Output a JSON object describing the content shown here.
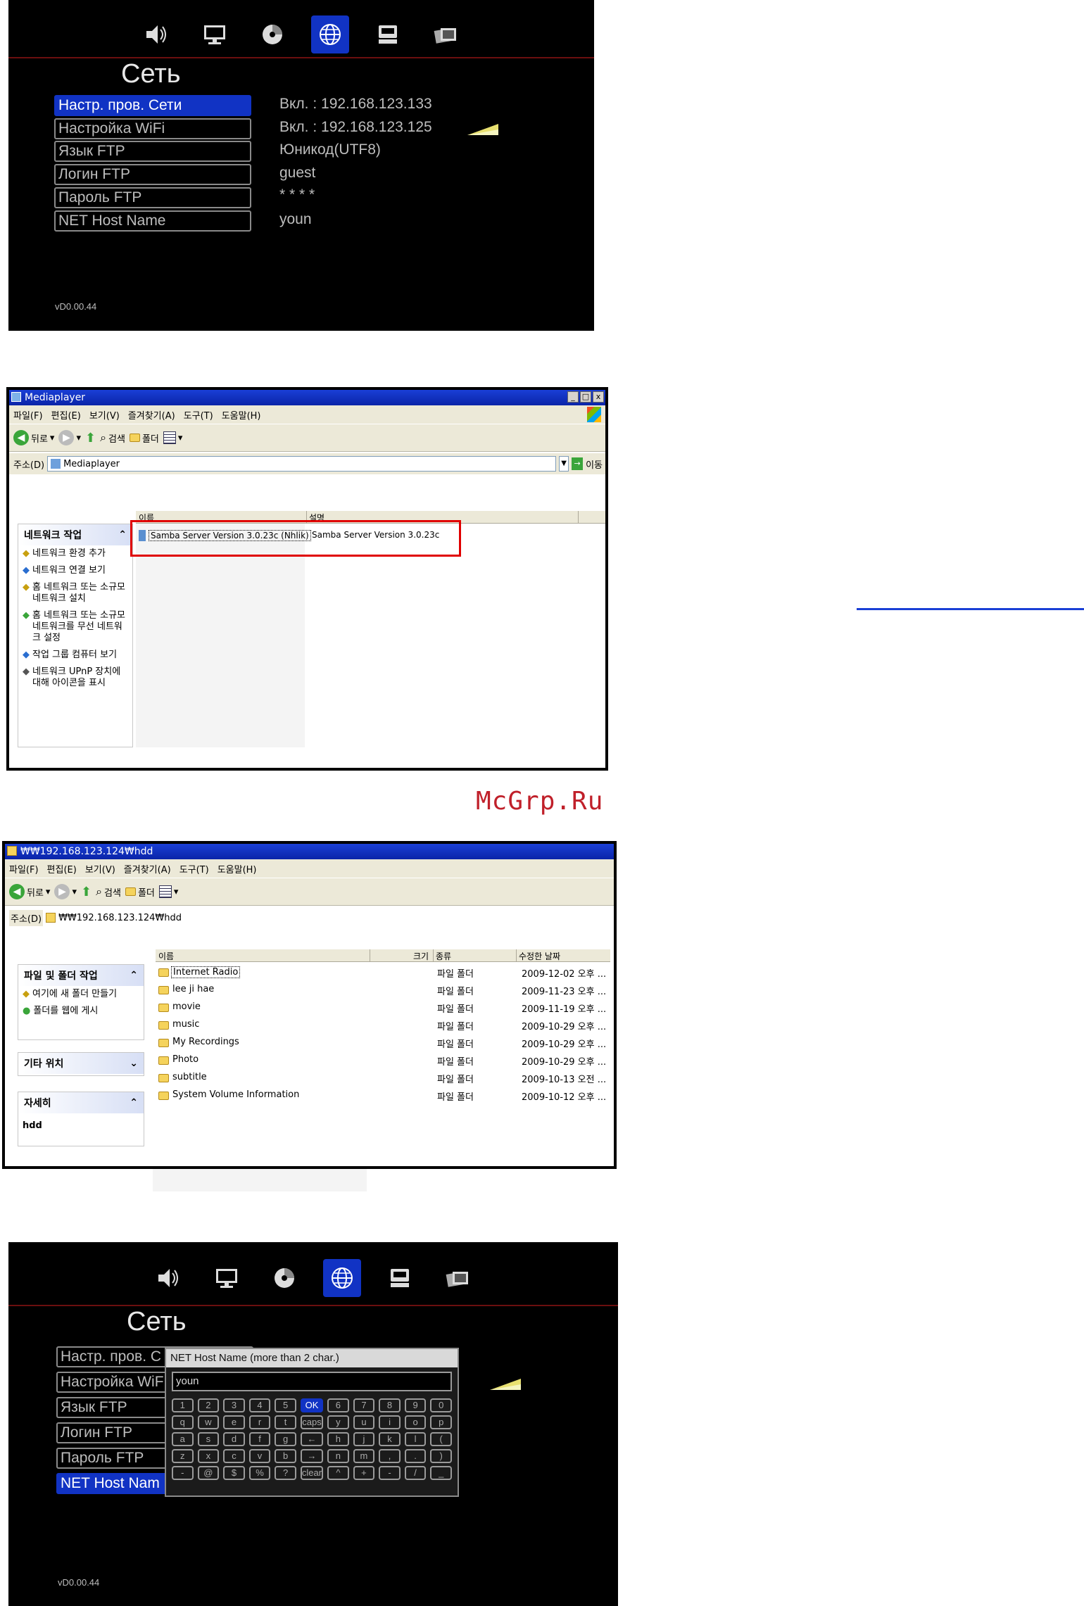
{
  "osd1": {
    "title": "Сеть",
    "menu": [
      {
        "label": "Настр. пров. Сети",
        "value": "Вкл. : 192.168.123.133"
      },
      {
        "label": "Настройка WiFi",
        "value": "Вкл. : 192.168.123.125"
      },
      {
        "label": "Язык FTP",
        "value": "Юникод(UTF8)"
      },
      {
        "label": "Логин FTP",
        "value": "guest"
      },
      {
        "label": "Пароль FTP",
        "value": "* * * *"
      },
      {
        "label": "NET Host Name",
        "value": "youn"
      }
    ],
    "selected_index": 0,
    "version": "vD0.00.44",
    "icons": [
      "speaker-icon",
      "monitor-icon",
      "disc-icon",
      "globe-icon",
      "network-drive-icon",
      "photo-icon"
    ],
    "active_icon": "globe-icon"
  },
  "win1": {
    "title": "Mediaplayer",
    "menu": [
      "파일(F)",
      "편집(E)",
      "보기(V)",
      "즐겨찾기(A)",
      "도구(T)",
      "도움말(H)"
    ],
    "toolbar": {
      "back": "뒤로",
      "search": "검색",
      "folders": "폴더"
    },
    "address_label": "주소(D)",
    "address_value": "Mediaplayer",
    "go_label": "이동",
    "side_title": "네트워크 작업",
    "side_items": [
      "네트워크 환경 추가",
      "네트워크 연결 보기",
      "홈 네트워크 또는 소규모 네트워크 설치",
      "홈 네트워크 또는 소규모 네트워크를 무선 네트워크 설정",
      "작업 그룹 컴퓨터 보기",
      "네트워크 UPnP 장치에 대해 아이콘을 표시"
    ],
    "columns": [
      "이름",
      "설명"
    ],
    "rows": [
      {
        "name": "Samba Server Version 3.0.23c (Nhlik)",
        "desc": "Samba Server Version 3.0.23c"
      }
    ]
  },
  "watermark": "McGrp.Ru",
  "win2": {
    "title": "₩₩192.168.123.124₩hdd",
    "menu": [
      "파일(F)",
      "편집(E)",
      "보기(V)",
      "즐겨찾기(A)",
      "도구(T)",
      "도움말(H)"
    ],
    "toolbar": {
      "back": "뒤로",
      "search": "검색",
      "folders": "폴더"
    },
    "address_label": "주소(D)",
    "address_value": "₩₩192.168.123.124₩hdd",
    "panels": [
      {
        "title": "파일 및 폴더 작업",
        "items": [
          "여기에 새 폴더 만들기",
          "폴더를 웹에 게시"
        ]
      },
      {
        "title": "기타 위치",
        "items": []
      },
      {
        "title": "자세히",
        "items": [
          "hdd"
        ]
      }
    ],
    "columns": [
      "이름",
      "크기",
      "종류",
      "수정한 날짜"
    ],
    "rows": [
      {
        "name": "Internet Radio",
        "type": "파일 폴더",
        "date": "2009-12-02 오후 ..."
      },
      {
        "name": "lee ji hae",
        "type": "파일 폴더",
        "date": "2009-11-23 오후 ..."
      },
      {
        "name": "movie",
        "type": "파일 폴더",
        "date": "2009-11-19 오후 ..."
      },
      {
        "name": "music",
        "type": "파일 폴더",
        "date": "2009-10-29 오후 ..."
      },
      {
        "name": "My Recordings",
        "type": "파일 폴더",
        "date": "2009-10-29 오후 ..."
      },
      {
        "name": "Photo",
        "type": "파일 폴더",
        "date": "2009-10-29 오후 ..."
      },
      {
        "name": "subtitle",
        "type": "파일 폴더",
        "date": "2009-10-13 오전 ..."
      },
      {
        "name": "System Volume Information",
        "type": "파일 폴더",
        "date": "2009-10-12 오후 ..."
      }
    ]
  },
  "osd2": {
    "title": "Сеть",
    "menu": [
      "Настр. пров. С",
      "Настройка WiF",
      "Язык FTP",
      "Логин FTP",
      "Пароль FTP",
      "NET Host Nam"
    ],
    "selected_index": 5,
    "version": "vD0.00.44",
    "dialog_title": "NET Host Name (more than 2 char.)",
    "dialog_value": "youn",
    "keys": [
      "1",
      "2",
      "3",
      "4",
      "5",
      "OK",
      "6",
      "7",
      "8",
      "9",
      "0",
      "q",
      "w",
      "e",
      "r",
      "t",
      "caps",
      "y",
      "u",
      "i",
      "o",
      "p",
      "a",
      "s",
      "d",
      "f",
      "g",
      "←",
      "h",
      "j",
      "k",
      "l",
      "(",
      "z",
      "x",
      "c",
      "v",
      "b",
      "→",
      "n",
      "m",
      ",",
      ".",
      ")",
      "-",
      "@",
      "$",
      "%",
      "?",
      "clear",
      "^",
      "+",
      "-",
      "/",
      "_"
    ],
    "highlight_key": "OK"
  }
}
